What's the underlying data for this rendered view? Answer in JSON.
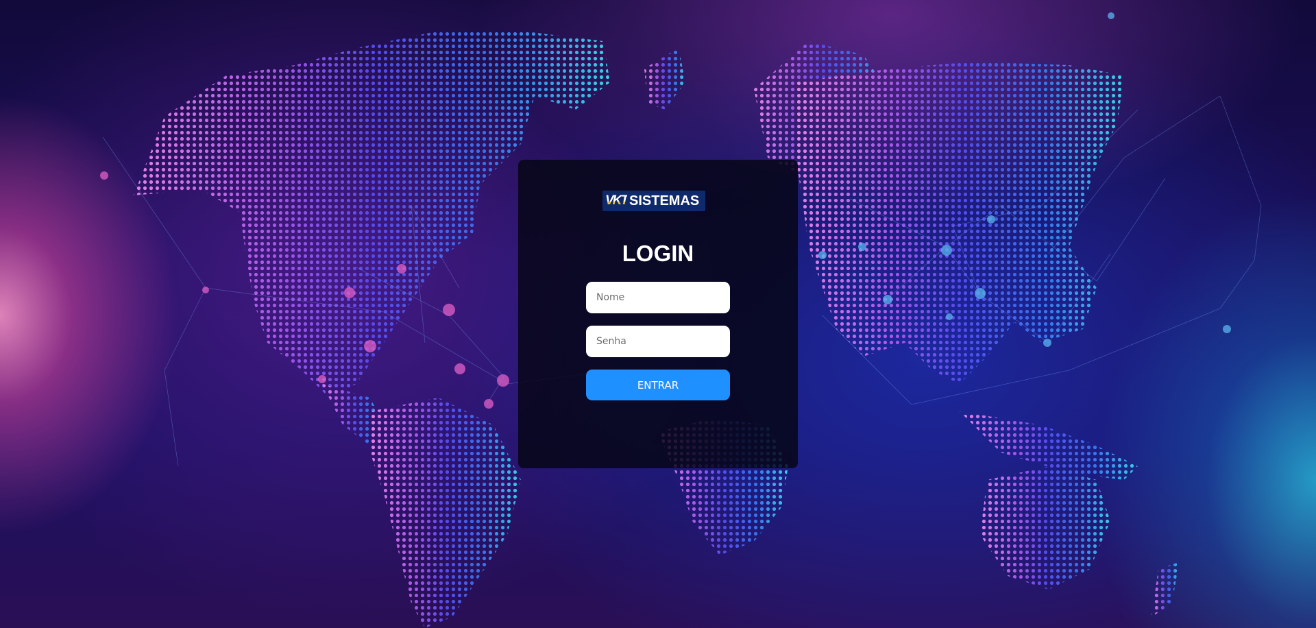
{
  "logo": {
    "mark": "VKT",
    "text": "SISTEMAS"
  },
  "login": {
    "title": "LOGIN",
    "name_placeholder": "Nome",
    "password_placeholder": "Senha",
    "submit_label": "ENTRAR"
  },
  "colors": {
    "button": "#1e90ff",
    "card_background": "rgba(6,6,22,0.84)",
    "title": "#ffffff"
  },
  "background": {
    "image": "world-map-network-icon"
  }
}
